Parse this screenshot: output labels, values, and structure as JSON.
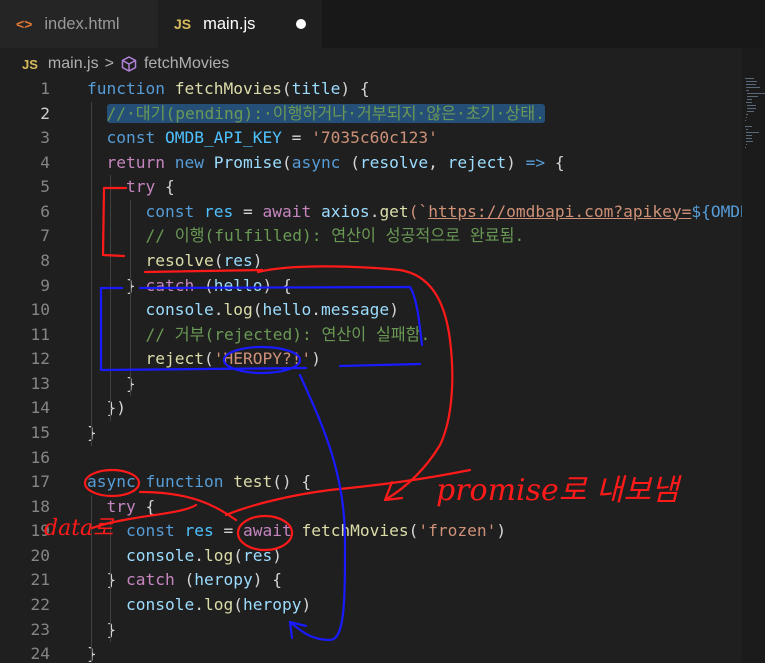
{
  "tabs": [
    {
      "label": "index.html",
      "icon": "html-brackets-icon",
      "icon_text": "<>"
    },
    {
      "label": "main.js",
      "icon": "js-icon",
      "icon_text": "JS",
      "unsaved": true
    }
  ],
  "breadcrumb": {
    "icon_text": "JS",
    "file": "main.js",
    "separator": ">",
    "symbol": "fetchMovies",
    "symbol_icon": "cube-icon"
  },
  "editor": {
    "current_line": 2,
    "lines": [
      [
        [
          "function ",
          "kw"
        ],
        [
          "fetchMovies",
          "fn"
        ],
        [
          "(",
          "pun"
        ],
        [
          "title",
          "var"
        ],
        [
          ") {",
          "pun"
        ]
      ],
      [
        [
          "  ",
          "pun"
        ],
        [
          "//·대기(pending):·이행하거나·거부되지·않은·초기·상태.",
          "com hl"
        ]
      ],
      [
        [
          "  ",
          "pun"
        ],
        [
          "const ",
          "kw"
        ],
        [
          "OMDB_API_KEY",
          "cst"
        ],
        [
          " = ",
          "pun"
        ],
        [
          "'7035c60c123'",
          "str"
        ]
      ],
      [
        [
          "  ",
          "pun"
        ],
        [
          "return ",
          "ctl"
        ],
        [
          "new ",
          "kw"
        ],
        [
          "Promise",
          "var"
        ],
        [
          "(",
          "pun"
        ],
        [
          "async ",
          "kw"
        ],
        [
          "(",
          "pun"
        ],
        [
          "resolve",
          "var"
        ],
        [
          ", ",
          "pun"
        ],
        [
          "reject",
          "var"
        ],
        [
          ") ",
          "pun"
        ],
        [
          "=>",
          "kw"
        ],
        [
          " {",
          "pun"
        ]
      ],
      [
        [
          "    ",
          "pun"
        ],
        [
          "try",
          "ctl"
        ],
        [
          " {",
          "pun"
        ]
      ],
      [
        [
          "      ",
          "pun"
        ],
        [
          "const ",
          "kw"
        ],
        [
          "res",
          "cst"
        ],
        [
          " = ",
          "pun"
        ],
        [
          "await ",
          "ctl"
        ],
        [
          "axios",
          "var"
        ],
        [
          ".",
          "pun"
        ],
        [
          "get",
          "fn"
        ],
        [
          "(`",
          "str"
        ],
        [
          "https://omdbapi.com?apikey=",
          "url"
        ],
        [
          "${OMDB_API_KEY}",
          "kw"
        ]
      ],
      [
        [
          "      ",
          "pun"
        ],
        [
          "// 이행(fulfilled): 연산이 성공적으로 완료됨.",
          "com"
        ]
      ],
      [
        [
          "      ",
          "pun"
        ],
        [
          "resolve",
          "fn"
        ],
        [
          "(",
          "pun"
        ],
        [
          "res",
          "var"
        ],
        [
          ")",
          "pun"
        ]
      ],
      [
        [
          "    ",
          "pun"
        ],
        [
          "} ",
          "pun"
        ],
        [
          "catch",
          "ctl"
        ],
        [
          " (",
          "pun"
        ],
        [
          "hello",
          "var"
        ],
        [
          ") {",
          "pun"
        ]
      ],
      [
        [
          "      ",
          "pun"
        ],
        [
          "console",
          "var"
        ],
        [
          ".",
          "pun"
        ],
        [
          "log",
          "fn"
        ],
        [
          "(",
          "pun"
        ],
        [
          "hello",
          "var"
        ],
        [
          ".",
          "pun"
        ],
        [
          "message",
          "var"
        ],
        [
          ")",
          "pun"
        ]
      ],
      [
        [
          "      ",
          "pun"
        ],
        [
          "// 거부(rejected): 연산이 실패함.",
          "com"
        ]
      ],
      [
        [
          "      ",
          "pun"
        ],
        [
          "reject",
          "fn"
        ],
        [
          "(",
          "pun"
        ],
        [
          "'HEROPY?!'",
          "str"
        ],
        [
          ")",
          "pun"
        ]
      ],
      [
        [
          "    ",
          "pun"
        ],
        [
          "}",
          "pun"
        ]
      ],
      [
        [
          "  ",
          "pun"
        ],
        [
          "})",
          "pun"
        ]
      ],
      [
        [
          "}",
          "pun"
        ]
      ],
      [],
      [
        [
          "async ",
          "kw"
        ],
        [
          "function ",
          "kw"
        ],
        [
          "test",
          "fn"
        ],
        [
          "() {",
          "pun"
        ]
      ],
      [
        [
          "  ",
          "pun"
        ],
        [
          "try",
          "ctl"
        ],
        [
          " {",
          "pun"
        ]
      ],
      [
        [
          "    ",
          "pun"
        ],
        [
          "const ",
          "kw"
        ],
        [
          "res",
          "cst"
        ],
        [
          " = ",
          "pun"
        ],
        [
          "await",
          "ctl"
        ],
        [
          " ",
          "pun"
        ],
        [
          "fetchMovies",
          "fn"
        ],
        [
          "(",
          "pun"
        ],
        [
          "'frozen'",
          "str"
        ],
        [
          ")",
          "pun"
        ]
      ],
      [
        [
          "    ",
          "pun"
        ],
        [
          "console",
          "var"
        ],
        [
          ".",
          "pun"
        ],
        [
          "log",
          "fn"
        ],
        [
          "(",
          "pun"
        ],
        [
          "res",
          "var"
        ],
        [
          ")",
          "pun"
        ]
      ],
      [
        [
          "  ",
          "pun"
        ],
        [
          "} ",
          "pun"
        ],
        [
          "catch",
          "ctl"
        ],
        [
          " (",
          "pun"
        ],
        [
          "heropy",
          "var"
        ],
        [
          ") {",
          "pun"
        ]
      ],
      [
        [
          "    ",
          "pun"
        ],
        [
          "console",
          "var"
        ],
        [
          ".",
          "pun"
        ],
        [
          "log",
          "fn"
        ],
        [
          "(",
          "pun"
        ],
        [
          "heropy",
          "var"
        ],
        [
          ")",
          "pun"
        ]
      ],
      [
        [
          "  ",
          "pun"
        ],
        [
          "}",
          "pun"
        ]
      ],
      [
        [
          "}",
          "pun"
        ]
      ]
    ]
  },
  "annotations": {
    "promise_note": "promise로 내보냄",
    "data_note": "data로",
    "ink_red": "#ff1a1a",
    "ink_blue": "#1a1aff"
  }
}
